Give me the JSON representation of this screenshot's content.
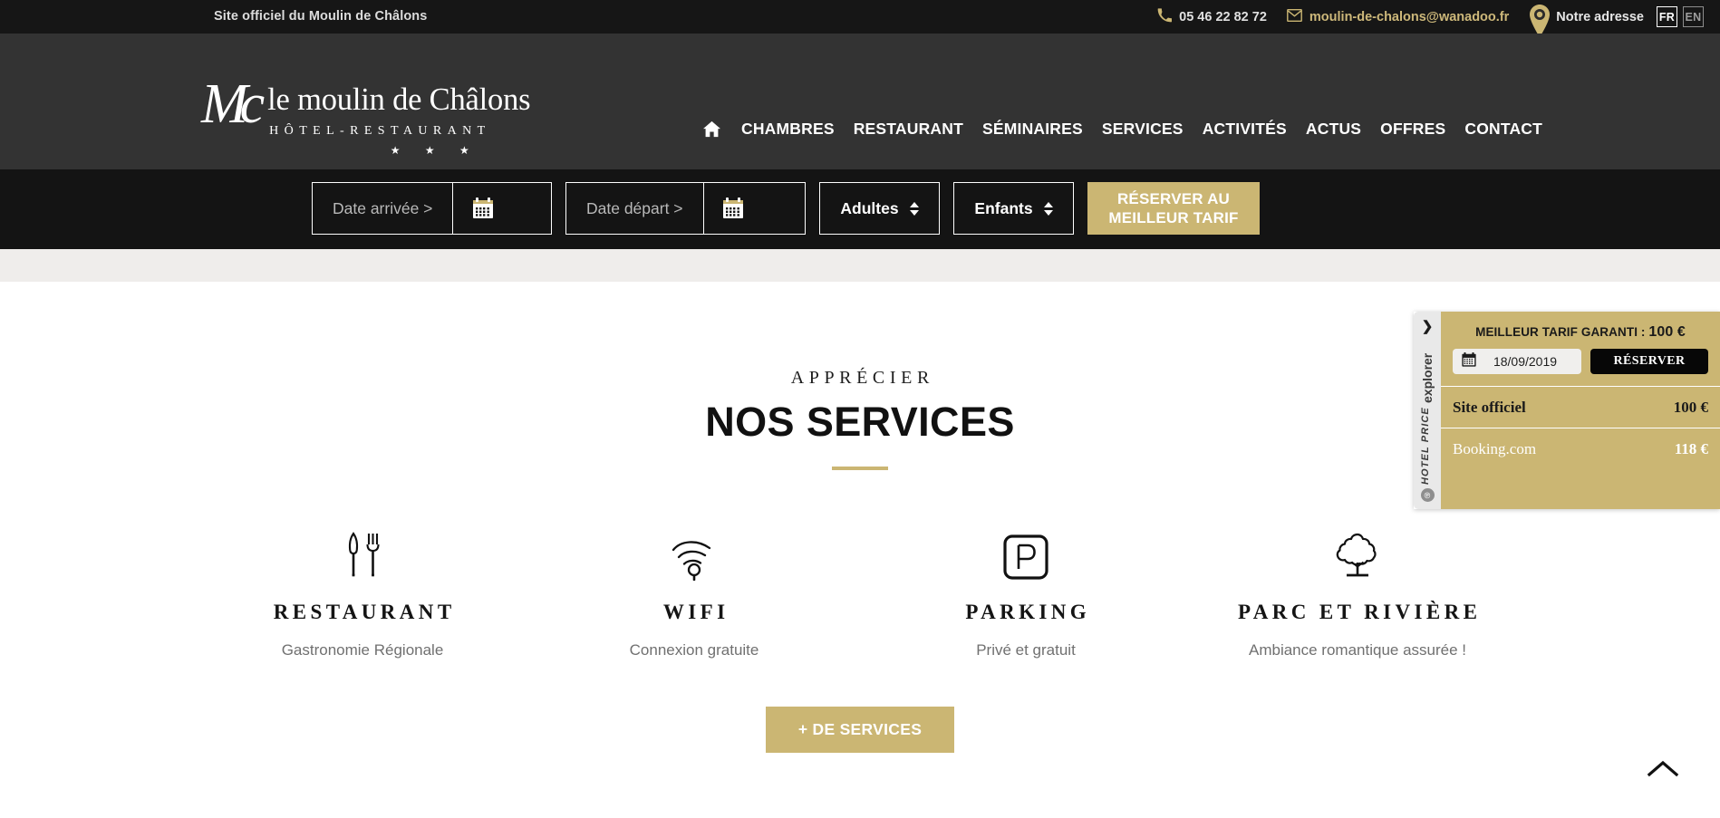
{
  "topbar": {
    "tagline": "Site officiel du Moulin de Châlons",
    "phone": "05 46 22 82 72",
    "phone_icon": "phone-icon",
    "email": "moulin-de-chalons@wanadoo.fr",
    "email_icon": "mail-icon",
    "address_label": "Notre adresse",
    "address_icon": "map-pin-icon",
    "lang_active": "FR",
    "lang_inactive": "EN"
  },
  "header": {
    "logo_mark": "Mc",
    "logo_name": "le moulin de Châlons",
    "logo_sub": "HÔTEL-RESTAURANT",
    "logo_stars": "★ ★ ★",
    "home_icon": "home-icon",
    "nav": [
      {
        "label": "CHAMBRES"
      },
      {
        "label": "RESTAURANT"
      },
      {
        "label": "SÉMINAIRES"
      },
      {
        "label": "SERVICES"
      },
      {
        "label": "ACTIVITÉS"
      },
      {
        "label": "ACTUS"
      },
      {
        "label": "OFFRES"
      },
      {
        "label": "CONTACT"
      }
    ]
  },
  "booking": {
    "arrival_placeholder": "Date arrivée >",
    "departure_placeholder": "Date départ >",
    "arrival_value": "",
    "departure_value": "",
    "calendar_icon": "calendar-icon",
    "adults_label": "Adultes",
    "children_label": "Enfants",
    "stepper_icon": "stepper-updown-icon",
    "submit_label": "RÉSERVER AU MEILLEUR TARIF"
  },
  "main": {
    "eyebrow": "APPRÉCIER",
    "title": "NOS SERVICES",
    "services": [
      {
        "icon": "cutlery-icon",
        "title": "RESTAURANT",
        "desc": "Gastronomie Régionale"
      },
      {
        "icon": "wifi-icon",
        "title": "WIFI",
        "desc": "Connexion gratuite"
      },
      {
        "icon": "parking-icon",
        "title": "PARKING",
        "desc": "Privé et gratuit"
      },
      {
        "icon": "tree-icon",
        "title": "PARC ET RIVIÈRE",
        "desc": "Ambiance romantique assurée !"
      }
    ],
    "more_button": "+ DE SERVICES",
    "scrolltop_icon": "chevron-up-icon"
  },
  "price_widget": {
    "tab_chevron": "❯",
    "tab_text_1": "HOTEL PRICE",
    "tab_text_2": "explorer",
    "tab_badge": "℗",
    "headline_text": "MEILLEUR TARIF GARANTI : ",
    "headline_amount": "100 €",
    "date_value": "18/09/2019",
    "date_icon": "calendar-icon",
    "reserve_label": "RÉSERVER",
    "rows": [
      {
        "name": "Site officiel",
        "price": "100 €"
      },
      {
        "name": "Booking.com",
        "price": "118 €"
      }
    ]
  },
  "colors": {
    "gold": "#cbb673",
    "topbar_bg": "#161616",
    "header_bg": "#333333",
    "booking_bg": "#141414",
    "grey_band": "#efedeb"
  }
}
